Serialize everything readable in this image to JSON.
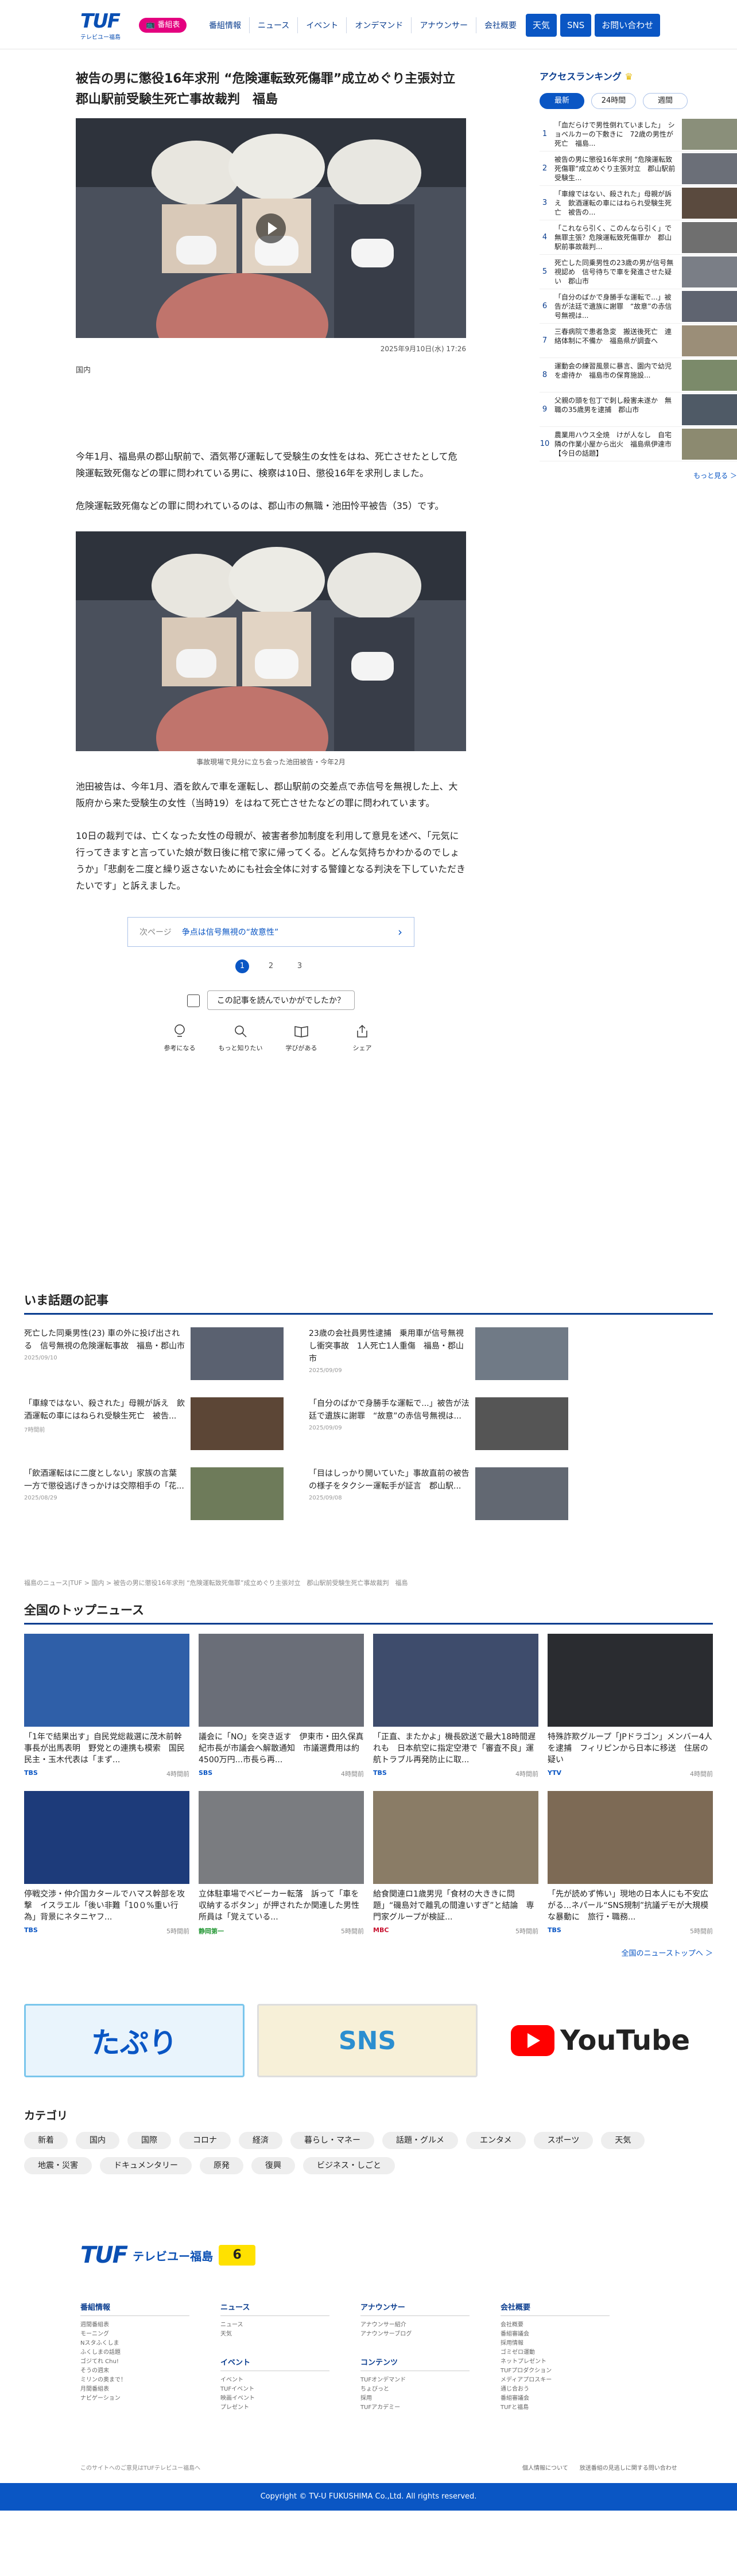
{
  "header": {
    "logo": "TUF",
    "logo_sub": "テレビユー福島",
    "onair_label": "番組表",
    "nav": [
      "番組情報",
      "ニュース",
      "イベント",
      "オンデマンド",
      "アナウンサー",
      "会社概要"
    ],
    "buttons": [
      "天気",
      "SNS",
      "お問い合わせ"
    ]
  },
  "article": {
    "title": "被告の男に懲役16年求刑 “危険運転致死傷罪”成立めぐり主張対立　郡山駅前受験生死亡事故裁判　福島",
    "date": "2025年9月10日(水) 17:26",
    "category": "国内",
    "paragraphs": [
      "今年1月、福島県の郡山駅前で、酒気帯び運転して受験生の女性をはね、死亡させたとして危険運転致死傷などの罪に問われている男に、検察は10日、懲役16年を求刑しました。",
      "危険運転致死傷などの罪に問われているのは、郡山市の無職・池田怜平被告（35）です。"
    ],
    "photo_caption": "事故現場で見分に立ち会った池田被告・今年2月",
    "paragraphs2": [
      "池田被告は、今年1月、酒を飲んで車を運転し、郡山駅前の交差点で赤信号を無視した上、大阪府から来た受験生の女性（当時19）をはねて死亡させたなどの罪に問われています。",
      "10日の裁判では、亡くなった女性の母親が、被害者参加制度を利用して意見を述べ、「元気に行ってきますと言っていた娘が数日後に棺で家に帰ってくる。どんな気持ちかわかるのでしょうか」「悲劇を二度と繰り返さないためにも社会全体に対する警鐘となる判決を下していただきたいです」と訴えました。"
    ],
    "next_label": "次ページ",
    "next_title": "争点は信号無視の“故意性”",
    "pages": [
      "1",
      "2",
      "3"
    ],
    "feedback_q": "この記事を読んでいかがでしたか？",
    "reactions": [
      "参考になる",
      "もっと知りたい",
      "学びがある",
      "シェア"
    ]
  },
  "ranking": {
    "title": "アクセスランキング",
    "tabs": [
      "最新",
      "24時間",
      "週間"
    ],
    "items": [
      {
        "n": "1",
        "t": "「血だらけで男性倒れていました」　ショベルカーの下敷きに　72歳の男性が死亡　福島..."
      },
      {
        "n": "2",
        "t": "被告の男に懲役16年求刑 “危険運転致死傷罪”成立めぐり主張対立　郡山駅前受験生..."
      },
      {
        "n": "3",
        "t": "「車線ではない、殺された」母親が訴え　飲酒運転の車にはねられ受験生死亡　被告の..."
      },
      {
        "n": "4",
        "t": "「これなら引く、このんなら引く」で無罪主張？危険運転致死傷罪か　郡山駅前事故裁判..."
      },
      {
        "n": "5",
        "t": "死亡した同乗男性の23歳の男が信号無視認め　信号待ちで車を発進させた疑い　郡山市"
      },
      {
        "n": "6",
        "t": "「自分のばかで身勝手な運転で...」被告が法廷で遺族に謝罪　“故意”の赤信号無視は..."
      },
      {
        "n": "7",
        "t": "三春病院で患者急変　搬送後死亡　連絡体制に不備か　福島県が調査へ"
      },
      {
        "n": "8",
        "t": "運動会の練習風景に暴言、園内で幼児を虐待か　福島市の保育施設..."
      },
      {
        "n": "9",
        "t": "父親の頭を包丁で刺し殺害未遂か　無職の35歳男を逮捕　郡山市"
      },
      {
        "n": "10",
        "t": "農業用ハウス全焼　けが人なし　自宅隣の作業小屋から出火　福島県伊達市【今日の話題】"
      }
    ],
    "more": "もっと見る ＞"
  },
  "related": {
    "title": "いま話題の記事",
    "items": [
      {
        "t": "死亡した同乗男性(23) 車の外に投げ出される　信号無視の危険運転事故　福島・郡山市",
        "d": "2025/09/10"
      },
      {
        "t": "23歳の会社員男性逮捕　乗用車が信号無視し衝突事故　1人死亡1人重傷　福島・郡山市",
        "d": "2025/09/09"
      },
      {
        "t": "「車線ではない、殺された」母親が訴え　飲酒運転の車にはねられ受験生死亡　被告...",
        "d": "7時間前"
      },
      {
        "t": "「自分のばかで身勝手な運転で...」被告が法廷で遺族に謝罪　“故意”の赤信号無視は...",
        "d": "2025/09/09"
      },
      {
        "t": "「飲酒運転はに二度としない」家族の言葉　一方で懲役逃げきっかけは交際相手の「花...",
        "d": "2025/08/29"
      },
      {
        "t": "「目はしっかり開いていた」事故直前の被告の様子をタクシー運転手が証言　郡山駅...",
        "d": "2025/09/08"
      }
    ]
  },
  "breadcrumb": "福島のニュース|TUF > 国内 > 被告の男に懲役16年求刑 “危険運転致死傷罪”成立めぐり主張対立　郡山駅前受験生死亡事故裁判　福島",
  "top_news": {
    "title": "全国のトップニュース",
    "items": [
      {
        "t": "「1年で結果出す」自民党総裁選に茂木前幹事長が出馬表明　野党との連携も模索　国民民主・玉木代表は「まず...",
        "src": "TBS",
        "time": "4時間前"
      },
      {
        "t": "議会に「NO」を突き返す　伊東市・田久保真紀市長が市議会へ解散通知　市議選費用は約4500万円...市長ら再...",
        "src": "SBS",
        "time": "4時間前"
      },
      {
        "t": "「正直、またかよ」機長欧送で最大18時間遅れも　日本航空に指定空港で「審査不良」運航トラブル再発防止に取...",
        "src": "TBS",
        "time": "4時間前"
      },
      {
        "t": "特殊詐欺グループ「JPドラゴン」メンバー4人を逮捕　フィリピンから日本に移送　住居の疑い",
        "src": "YTV",
        "time": "4時間前"
      },
      {
        "t": "停戦交渉・仲介国カタールでハマス幹部を攻撃　イスラエル「後い非難「10０%重い行為」背景にネタニヤフ...",
        "src": "TBS",
        "time": "5時間前"
      },
      {
        "t": "立体駐車場でベビーカー転落　訴って「車を収納するボタン」が押されたか関連した男性所員は「覚えている...",
        "src": "静岡第一",
        "time": "5時間前"
      },
      {
        "t": "給食関連ロ1歳男児「食材の大ききに問題」“磯島対で離乳の間違いすぎ”と結論　専門家グループが検証...",
        "src": "MBC",
        "time": "5時間前"
      },
      {
        "t": "「先が読めず怖い」現地の日本人にも不安広がる...ネパール“SNS規制”抗議デモが大規模な暴動に　旅行・職務...",
        "src": "TBS",
        "time": "5時間前"
      }
    ],
    "more": "全国のニューストップへ ＞"
  },
  "banners": [
    "たぷり",
    "SNS",
    "YouTube"
  ],
  "categories": {
    "title": "カテゴリ",
    "items": [
      "新着",
      "国内",
      "国際",
      "コロナ",
      "経済",
      "暮らし・マネー",
      "話題・グルメ",
      "エンタメ",
      "スポーツ",
      "天気",
      "地震・災害",
      "ドキュメンタリー",
      "原発",
      "復興",
      "ビジネス・しごと"
    ]
  },
  "footer": {
    "logo": "TUF",
    "name": "テレビユー福島",
    "ch": "6",
    "cols": [
      {
        "h": "番組情報",
        "items": [
          "週間番組表",
          "モーニング",
          "Nスタふくしま",
          "ふくしまの話題",
          "ゴジてれ Chu!",
          "そうの週末",
          "ミリンの奥まで！",
          "月間番組表",
          "ナビゲーション"
        ]
      },
      {
        "h": "ニュース",
        "items": [
          "ニュース",
          "天気"
        ]
      },
      {
        "h": "イベント",
        "items": [
          "イベント",
          "TUFイベント",
          "映画イベント",
          "プレゼント"
        ]
      },
      {
        "h": "アナウンサー",
        "items": [
          "アナウンサー紹介",
          "アナウンサーブログ"
        ]
      },
      {
        "h": "コンテンツ",
        "items": [
          "TUFオンデマンド",
          "ちょびっと",
          "採用",
          "TUFアカデミー"
        ]
      },
      {
        "h": "会社概要",
        "items": [
          "会社概要",
          "番組審議会",
          "採用情報",
          "ゴミゼロ運動",
          "ネットプレゼント",
          "TUFプロダクション",
          "メディアプロスキー",
          "通じ合おう",
          "番組審議会",
          "TUFと福島"
        ]
      }
    ],
    "note": "このサイトへのご意見はTUFテレビユー福島へ",
    "links": [
      "個人情報について",
      "放送番組の見逃しに関する問い合わせ"
    ],
    "copyright": "Copyright © TV-U FUKUSHIMA Co.,Ltd. All rights reserved."
  }
}
